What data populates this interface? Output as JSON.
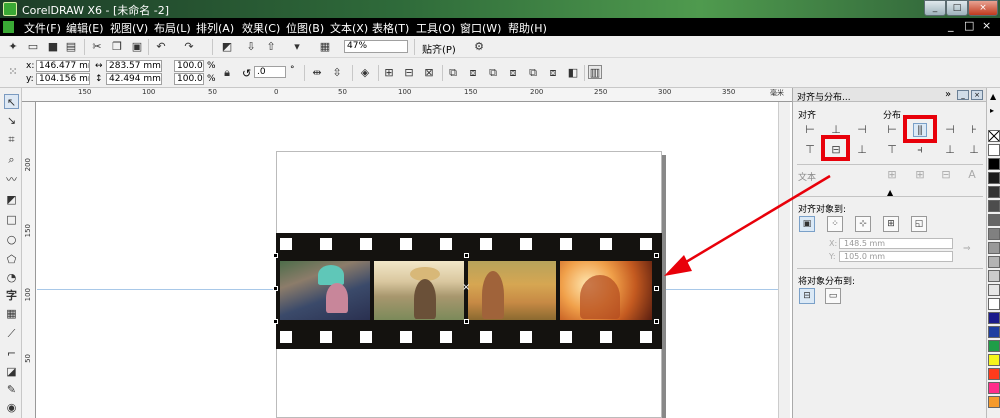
{
  "window": {
    "title": "CorelDRAW X6 - [未命名 -2]",
    "controls": {
      "minimize": "_",
      "restore": "□",
      "close": "×"
    }
  },
  "menubar": {
    "items": [
      "文件(F)",
      "编辑(E)",
      "视图(V)",
      "布局(L)",
      "排列(A)",
      "效果(C)",
      "位图(B)",
      "文本(X)",
      "表格(T)",
      "工具(O)",
      "窗口(W)",
      "帮助(H)"
    ],
    "doc_controls": {
      "minimize": "_",
      "restore": "□",
      "close": "×"
    }
  },
  "standard_toolbar": {
    "zoom": "47%",
    "snap_label": "贴齐(P)"
  },
  "property_bar": {
    "x_label": "x:",
    "x_value": "146.477 mm",
    "y_label": "y:",
    "y_value": "104.156 mm",
    "width_value": "283.57 mm",
    "height_value": "42.494 mm",
    "scale_x": "100.0",
    "scale_y": "100.0",
    "percent": "%",
    "rotation": ".0",
    "degree": "°"
  },
  "rulers": {
    "top_ticks": [
      "150",
      "100",
      "50",
      "0",
      "50",
      "100",
      "150",
      "200",
      "250",
      "300",
      "350",
      "毫米"
    ],
    "left_ticks": [
      "200",
      "150",
      "100",
      "50"
    ]
  },
  "docker": {
    "title": "对齐与分布...",
    "align_label": "对齐",
    "distribute_label": "分布",
    "text_label": "文本",
    "align_to_label": "对齐对象到:",
    "x_label": "X:",
    "x_value": "148.5 mm",
    "y_label": "Y:",
    "y_value": "105.0 mm",
    "distribute_to_label": "将对象分布到:"
  },
  "palette": {
    "colors": [
      "#ffffff",
      "#000000",
      "#1a1a1a",
      "#333333",
      "#4d4d4d",
      "#666666",
      "#808080",
      "#999999",
      "#b3b3b3",
      "#cccccc",
      "#e6e6e6",
      "#ffffff",
      "#1c1c8c",
      "#1f3fa0",
      "#1f9d48",
      "#f5f51c",
      "#ff3b1c",
      "#ff2d8a",
      "#f59a2c",
      "#f0c8c8"
    ]
  },
  "colors": {
    "highlight": "#e8000a",
    "arrow": "#e8000a",
    "film": "#14120f"
  }
}
